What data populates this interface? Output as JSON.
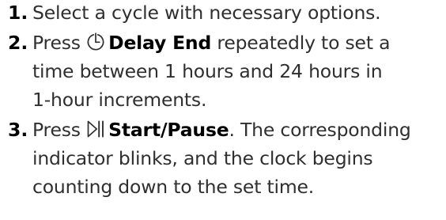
{
  "steps": [
    {
      "number": "1.",
      "text": "Select a cycle with necessary options."
    },
    {
      "number": "2.",
      "prefix": "Press",
      "icon": "delay-timer-icon",
      "command": "Delay End",
      "line1_suffix": "repeatedly to set a",
      "line2": "time between 1 hours and 24 hours in",
      "line3": "1-hour increments."
    },
    {
      "number": "3.",
      "prefix": "Press",
      "icon": "play-pause-icon",
      "command": "Start/Pause",
      "line1_suffix": ". The corresponding",
      "line2": "indicator blinks, and the clock begins",
      "line3": "counting down to the set time."
    }
  ]
}
